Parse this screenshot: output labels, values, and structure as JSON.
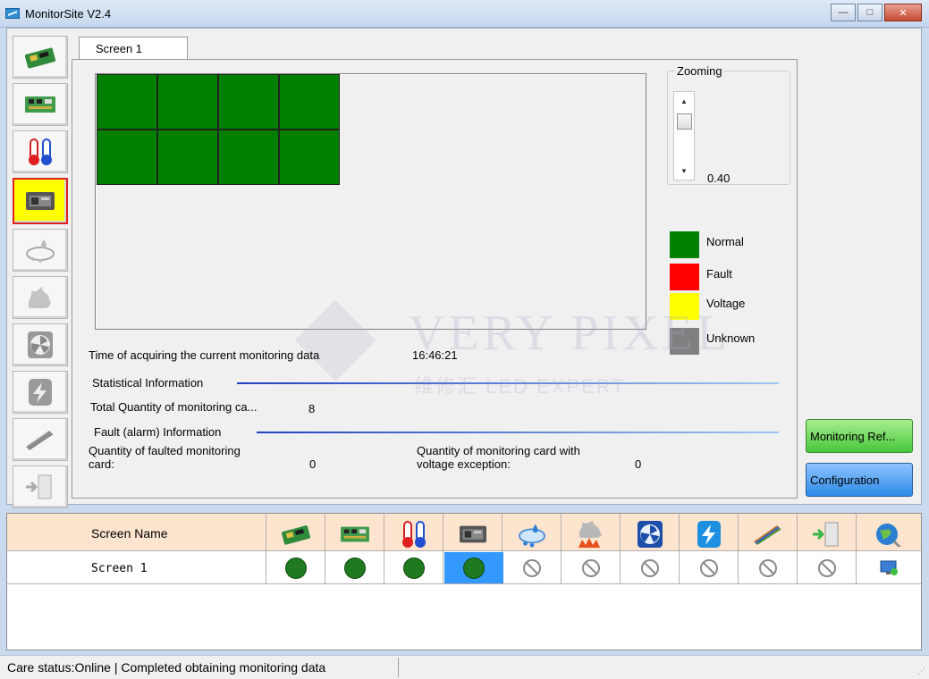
{
  "window": {
    "title": "MonitorSite V2.4",
    "minimize_glyph": "—",
    "maximize_glyph": "□",
    "close_glyph": "✕"
  },
  "sidebar": {
    "items": [
      {
        "icon": "receiving-card-icon",
        "selected": false,
        "enabled": true
      },
      {
        "icon": "monitoring-card-icon",
        "selected": false,
        "enabled": true
      },
      {
        "icon": "temperature-humidity-icon",
        "selected": false,
        "enabled": true
      },
      {
        "icon": "cabinet-icon",
        "selected": true,
        "enabled": true
      },
      {
        "icon": "smoke-humidity-icon",
        "selected": false,
        "enabled": false
      },
      {
        "icon": "smoke-icon",
        "selected": false,
        "enabled": false
      },
      {
        "icon": "fan-icon",
        "selected": false,
        "enabled": false
      },
      {
        "icon": "power-icon",
        "selected": false,
        "enabled": false
      },
      {
        "icon": "ribbon-cable-icon",
        "selected": false,
        "enabled": false
      },
      {
        "icon": "door-icon",
        "selected": false,
        "enabled": false
      }
    ]
  },
  "tab": {
    "label": "Screen 1"
  },
  "zoom": {
    "label": "Zooming",
    "value": "0.40",
    "up_glyph": "▲",
    "down_glyph": "▼"
  },
  "legend": [
    {
      "label": "Normal",
      "color": "#008000"
    },
    {
      "label": "Fault",
      "color": "#ff0000"
    },
    {
      "label": "Voltage",
      "color": "#ffff00"
    },
    {
      "label": "Unknown",
      "color": "#808080"
    }
  ],
  "watermark": {
    "main": "VERY PIXEL",
    "sub": "维修汇 LED EXPERT"
  },
  "info": {
    "time_label": "Time of acquiring the current monitoring data",
    "time_value": "16:46:21",
    "stats_title": "Statistical Information",
    "total_label": "Total Quantity of monitoring ca...",
    "total_value": "8",
    "fault_title": "Fault (alarm) Information",
    "faulted_label_1": "Quantity of faulted monitoring",
    "faulted_label_2": "card:",
    "faulted_value": "0",
    "voltage_label_1": "Quantity of monitoring card with",
    "voltage_label_2": "voltage exception:",
    "voltage_value": "0"
  },
  "buttons": {
    "refresh": "Monitoring Ref...",
    "config": "Configuration"
  },
  "grid": {
    "header": "Screen Name",
    "columns": [
      "receiving-card-icon",
      "monitoring-card-icon",
      "temperature-icon",
      "cabinet-icon",
      "humidity-icon",
      "smoke-icon",
      "fan-icon",
      "power-icon",
      "ribbon-cable-icon",
      "door-icon",
      "network-icon"
    ],
    "rows": [
      {
        "name": "Screen  1",
        "status": [
          "ok",
          "ok",
          "ok",
          "ok",
          "na",
          "na",
          "na",
          "na",
          "na",
          "na",
          "online"
        ]
      }
    ]
  },
  "status": {
    "text": "Care status:Online  |  Completed obtaining monitoring data"
  }
}
